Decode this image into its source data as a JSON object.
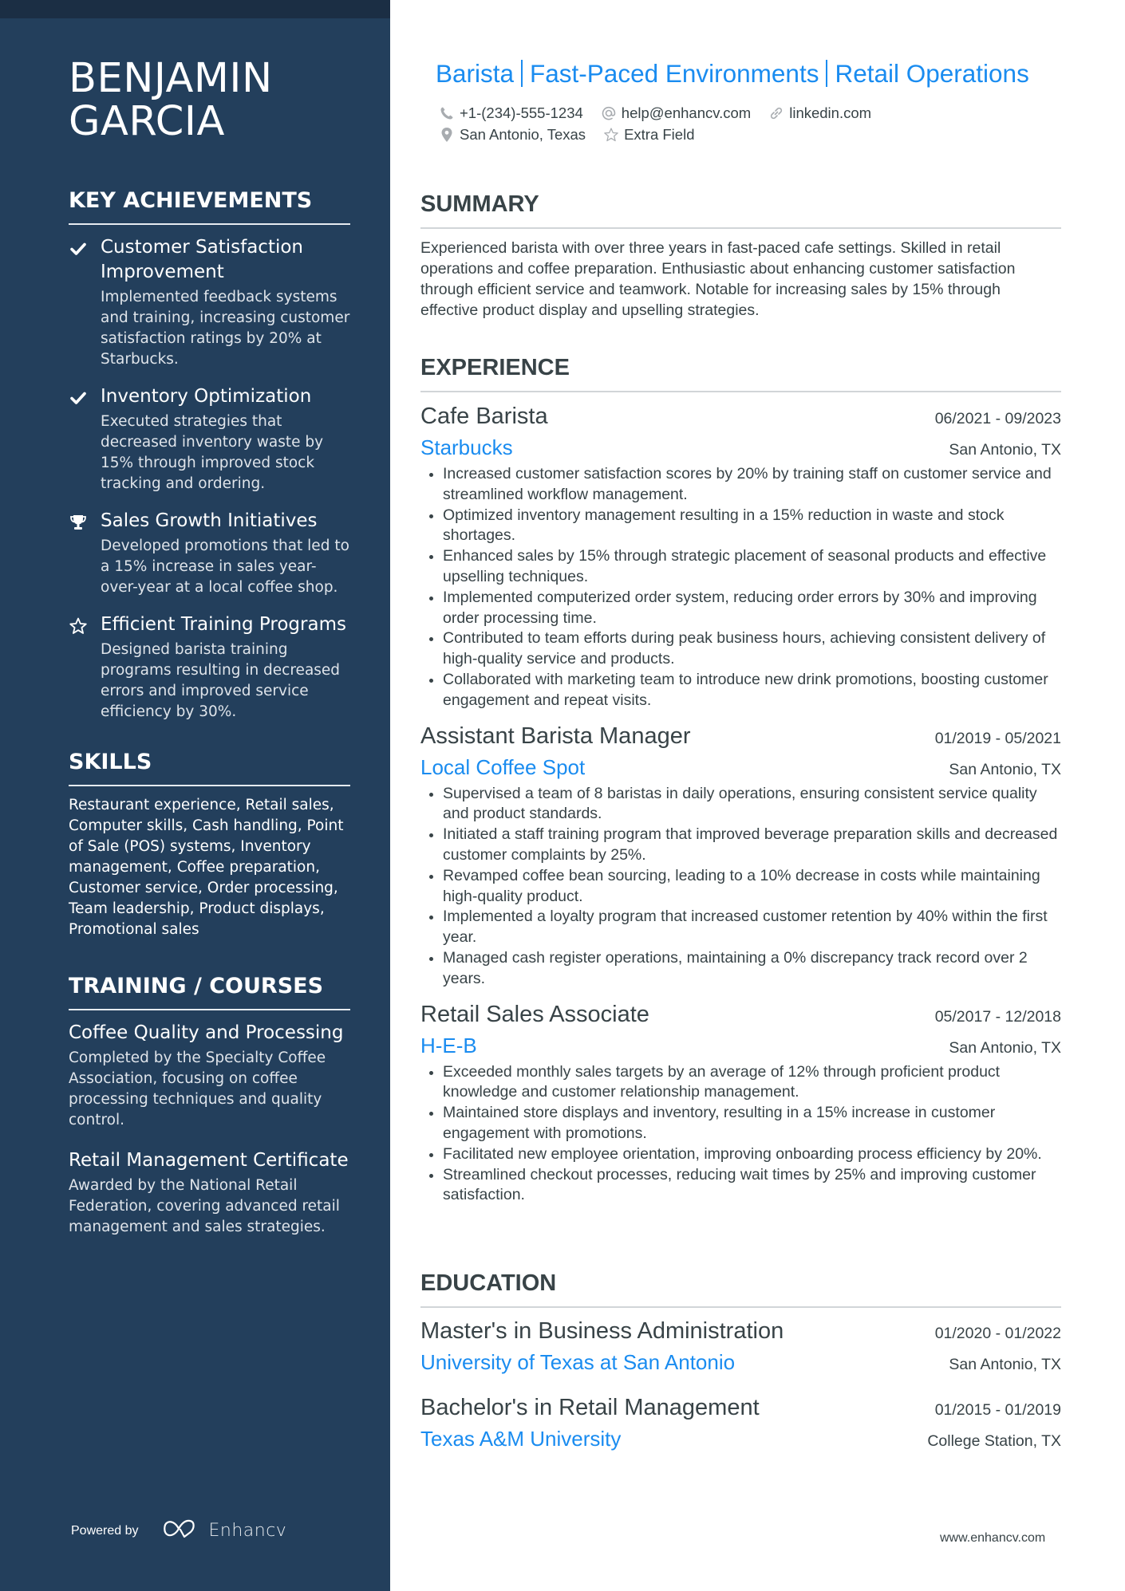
{
  "profile": {
    "name_lines": [
      "BENJAMIN",
      "GARCIA"
    ],
    "headline_parts": [
      "Barista",
      "Fast-Paced Environments",
      "Retail Operations"
    ],
    "contacts": {
      "phone": "+1-(234)-555-1234",
      "email": "help@enhancv.com",
      "link": "linkedin.com",
      "location": "San Antonio, Texas",
      "extra": "Extra Field"
    }
  },
  "colors": {
    "sidebar_bg": "#233f5c",
    "sidebar_topband": "#1b2e44",
    "accent": "#1a8cf0",
    "text": "#384347"
  },
  "sidebar": {
    "achievements": {
      "title": "KEY ACHIEVEMENTS",
      "items": [
        {
          "icon": "check-icon",
          "title": "Customer Satisfaction Improvement",
          "desc": "Implemented feedback systems and training, increasing customer satisfaction ratings by 20% at Starbucks."
        },
        {
          "icon": "check-icon",
          "title": "Inventory Optimization",
          "desc": "Executed strategies that decreased inventory waste by 15% through improved stock tracking and ordering."
        },
        {
          "icon": "trophy-icon",
          "title": "Sales Growth Initiatives",
          "desc": "Developed promotions that led to a 15% increase in sales year-over-year at a local coffee shop."
        },
        {
          "icon": "star-outline-icon",
          "title": "Efficient Training Programs",
          "desc": "Designed barista training programs resulting in decreased errors and improved service efficiency by 30%."
        }
      ]
    },
    "skills": {
      "title": "SKILLS",
      "text": "Restaurant experience, Retail sales, Computer skills, Cash handling, Point of Sale (POS) systems, Inventory management, Coffee preparation, Customer service, Order processing, Team leadership, Product displays, Promotional sales"
    },
    "training": {
      "title": "TRAINING / COURSES",
      "items": [
        {
          "title": "Coffee Quality and Processing",
          "desc": "Completed by the Specialty Coffee Association, focusing on coffee processing techniques and quality control."
        },
        {
          "title": "Retail Management Certificate",
          "desc": "Awarded by the National Retail Federation, covering advanced retail management and sales strategies."
        }
      ]
    },
    "powered_by": "Powered by",
    "brand": "Enhancv"
  },
  "main": {
    "summary": {
      "title": "SUMMARY",
      "text": "Experienced barista with over three years in fast-paced cafe settings. Skilled in retail operations and coffee preparation. Enthusiastic about enhancing customer satisfaction through efficient service and teamwork. Notable for increasing sales by 15% through effective product display and upselling strategies."
    },
    "experience": {
      "title": "EXPERIENCE",
      "items": [
        {
          "role": "Cafe Barista",
          "dates": "06/2021 - 09/2023",
          "company": "Starbucks",
          "location": "San Antonio, TX",
          "bullets": [
            "Increased customer satisfaction scores by 20% by training staff on customer service and streamlined workflow management.",
            "Optimized inventory management resulting in a 15% reduction in waste and stock shortages.",
            "Enhanced sales by 15% through strategic placement of seasonal products and effective upselling techniques.",
            "Implemented computerized order system, reducing order errors by 30% and improving order processing time.",
            "Contributed to team efforts during peak business hours, achieving consistent delivery of high-quality service and products.",
            "Collaborated with marketing team to introduce new drink promotions, boosting customer engagement and repeat visits."
          ]
        },
        {
          "role": "Assistant Barista Manager",
          "dates": "01/2019 - 05/2021",
          "company": "Local Coffee Spot",
          "location": "San Antonio, TX",
          "bullets": [
            "Supervised a team of 8 baristas in daily operations, ensuring consistent service quality and product standards.",
            "Initiated a staff training program that improved beverage preparation skills and decreased customer complaints by 25%.",
            "Revamped coffee bean sourcing, leading to a 10% decrease in costs while maintaining high-quality product.",
            "Implemented a loyalty program that increased customer retention by 40% within the first year.",
            "Managed cash register operations, maintaining a 0% discrepancy track record over 2 years."
          ]
        },
        {
          "role": "Retail Sales Associate",
          "dates": "05/2017 - 12/2018",
          "company": "H-E-B",
          "location": "San Antonio, TX",
          "bullets": [
            "Exceeded monthly sales targets by an average of 12% through proficient product knowledge and customer relationship management.",
            "Maintained store displays and inventory, resulting in a 15% increase in customer engagement with promotions.",
            "Facilitated new employee orientation, improving onboarding process efficiency by 20%.",
            "Streamlined checkout processes, reducing wait times by 25% and improving customer satisfaction."
          ]
        }
      ]
    },
    "education": {
      "title": "EDUCATION",
      "items": [
        {
          "degree": "Master's in Business Administration",
          "dates": "01/2020 - 01/2022",
          "school": "University of Texas at San Antonio",
          "location": "San Antonio, TX"
        },
        {
          "degree": "Bachelor's in Retail Management",
          "dates": "01/2015 - 01/2019",
          "school": "Texas A&M University",
          "location": "College Station, TX"
        }
      ]
    }
  },
  "footer": {
    "url": "www.enhancv.com"
  }
}
